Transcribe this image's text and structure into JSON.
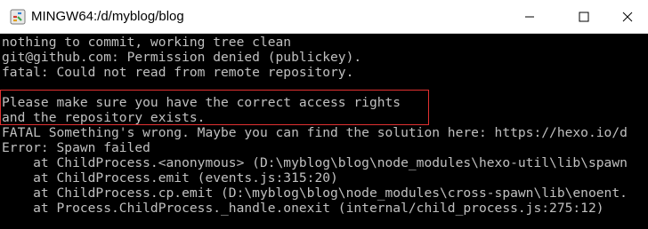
{
  "window": {
    "title": "MINGW64:/d/myblog/blog"
  },
  "icons": {
    "app": "mingw-terminal-icon",
    "minimize": "minimize-icon",
    "maximize": "maximize-icon",
    "close": "close-icon"
  },
  "colors": {
    "terminal_bg": "#000000",
    "terminal_fg": "#c0c0c0",
    "highlight_border": "#e03030",
    "titlebar_bg": "#ffffff"
  },
  "terminal": {
    "lines": [
      "nothing to commit, working tree clean",
      "git@github.com: Permission denied (publickey).",
      "fatal: Could not read from remote repository.",
      "",
      "Please make sure you have the correct access rights",
      "and the repository exists.",
      "FATAL Something's wrong. Maybe you can find the solution here: https://hexo.io/d",
      "Error: Spawn failed",
      "    at ChildProcess.<anonymous> (D:\\myblog\\blog\\node_modules\\hexo-util\\lib\\spawn",
      "    at ChildProcess.emit (events.js:315:20)",
      "    at ChildProcess.cp.emit (D:\\myblog\\blog\\node_modules\\cross-spawn\\lib\\enoent.",
      "    at Process.ChildProcess._handle.onexit (internal/child_process.js:275:12)"
    ]
  }
}
